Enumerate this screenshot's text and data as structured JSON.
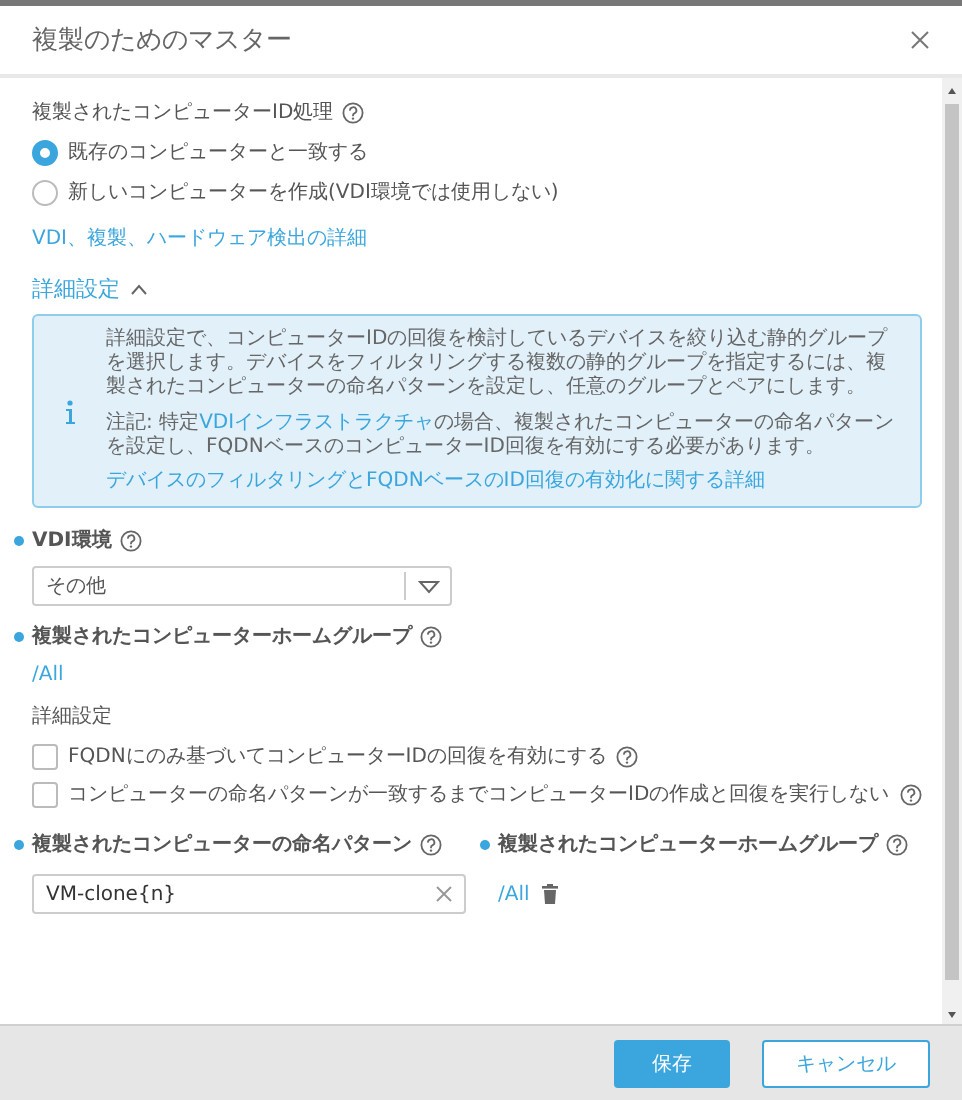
{
  "dialog": {
    "title": "複製のためのマスター"
  },
  "id_handling": {
    "label": "複製されたコンピューターID処理",
    "options": [
      {
        "label": "既存のコンピューターと一致する",
        "selected": true
      },
      {
        "label": "新しいコンピューターを作成(VDI環境では使用しない)",
        "selected": false
      }
    ],
    "link": "VDI、複製、ハードウェア検出の詳細"
  },
  "advanced": {
    "label": "詳細設定",
    "expanded": true,
    "info": {
      "paragraph": "詳細設定で、コンピューターIDの回復を検討しているデバイスを絞り込む静的グループを選択します。デバイスをフィルタリングする複数の静的グループを指定するには、複製されたコンピューターの命名パターンを設定し、任意のグループとペアにします。",
      "note": {
        "before": "注記: 特定",
        "link": "VDIインフラストラクチャ",
        "after": "の場合、複製されたコンピューターの命名パターンを設定し、FQDNベースのコンピューターID回復を有効にする必要があります。"
      },
      "link": "デバイスのフィルタリングとFQDNベースのID回復の有効化に関する詳細"
    }
  },
  "vdi_environment": {
    "label": "VDI環境",
    "required": true,
    "value": "その他"
  },
  "home_group": {
    "label": "複製されたコンピューターホームグループ",
    "required": true,
    "value": "/All"
  },
  "detail_settings": {
    "label": "詳細設定",
    "checkboxes": [
      {
        "label": "FQDNにのみ基づいてコンピューターIDの回復を有効にする",
        "checked": false
      },
      {
        "label": "コンピューターの命名パターンが一致するまでコンピューターIDの作成と回復を実行しない",
        "checked": false
      }
    ]
  },
  "naming": {
    "label": "複製されたコンピューターの命名パターン",
    "required": true,
    "value": "VM-clone{n}"
  },
  "pair_group": {
    "label": "複製されたコンピューターホームグループ",
    "required": true,
    "value": "/All"
  },
  "buttons": [
    {
      "label": "保存",
      "kind": "primary"
    },
    {
      "label": "キャンセル",
      "kind": "secondary"
    }
  ]
}
